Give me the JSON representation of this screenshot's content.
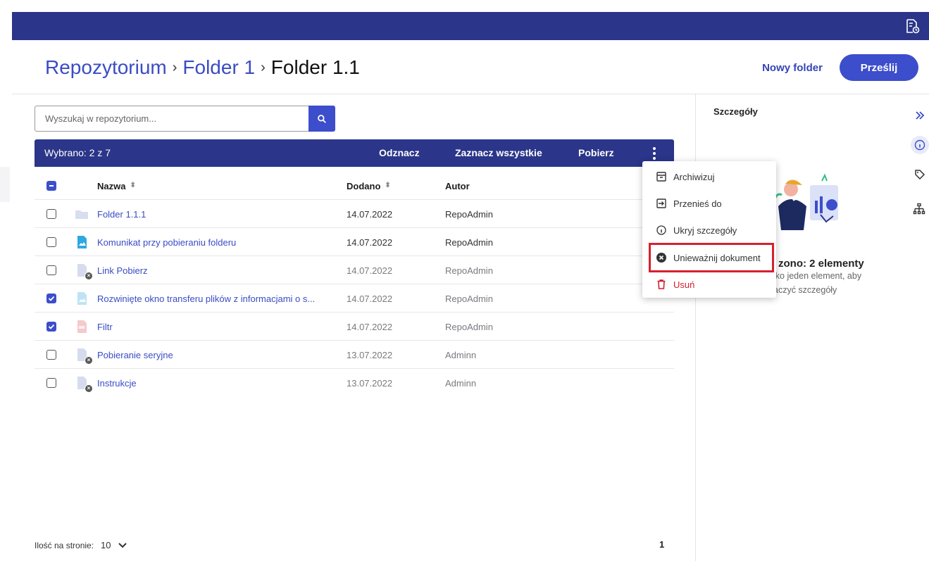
{
  "colors": {
    "header_bg": "#2b3589",
    "accent": "#3c4ecb",
    "link": "#3a4cc4",
    "danger": "#d11f2d"
  },
  "breadcrumb": {
    "root": "Repozytorium",
    "parent": "Folder 1",
    "current": "Folder 1.1",
    "separator": "›"
  },
  "toolbar": {
    "new_folder": "Nowy folder",
    "upload": "Prześlij"
  },
  "search": {
    "placeholder": "Wyszukaj w repozytorium...",
    "icon": "search-icon"
  },
  "selection": {
    "count_label": "Wybrano: 2 z 7",
    "deselect": "Odznacz",
    "select_all": "Zaznacz wszystkie",
    "download": "Pobierz"
  },
  "table": {
    "columns": {
      "name": "Nazwa",
      "added": "Dodano",
      "author": "Autor"
    },
    "rows": [
      {
        "name": "Folder 1.1.1",
        "date": "14.07.2022",
        "author": "RepoAdmin",
        "checked": false,
        "icon": "folder-icon"
      },
      {
        "name": "Komunikat przy pobieraniu folderu",
        "date": "14.07.2022",
        "author": "RepoAdmin",
        "checked": false,
        "icon": "image-file-icon"
      },
      {
        "name": "Link Pobierz",
        "date": "14.07.2022",
        "author": "RepoAdmin",
        "checked": false,
        "icon": "invalid-file-icon"
      },
      {
        "name": "Rozwinięte okno transferu plików z informacjami o s...",
        "date": "14.07.2022",
        "author": "RepoAdmin",
        "checked": true,
        "icon": "image-file-icon"
      },
      {
        "name": "Filtr",
        "date": "14.07.2022",
        "author": "RepoAdmin",
        "checked": true,
        "icon": "pdf-file-icon"
      },
      {
        "name": "Pobieranie seryjne",
        "date": "13.07.2022",
        "author": "Adminn",
        "checked": false,
        "icon": "invalid-file-icon"
      },
      {
        "name": "Instrukcje",
        "date": "13.07.2022",
        "author": "Adminn",
        "checked": false,
        "icon": "invalid-file-icon"
      }
    ]
  },
  "pagination": {
    "per_page_label": "Ilość na stronie:",
    "per_page_value": "10",
    "current_page": "1"
  },
  "details": {
    "title": "Szczegóły",
    "empty_title": "zono: 2 elementy",
    "empty_line1": "lko jeden element, aby",
    "empty_line2": "aczyć szczegóły"
  },
  "context_menu": {
    "archive": "Archiwizuj",
    "move_to": "Przenieś do",
    "hide_details": "Ukryj szczegóły",
    "invalidate": "Unieważnij dokument",
    "delete": "Usuń"
  }
}
